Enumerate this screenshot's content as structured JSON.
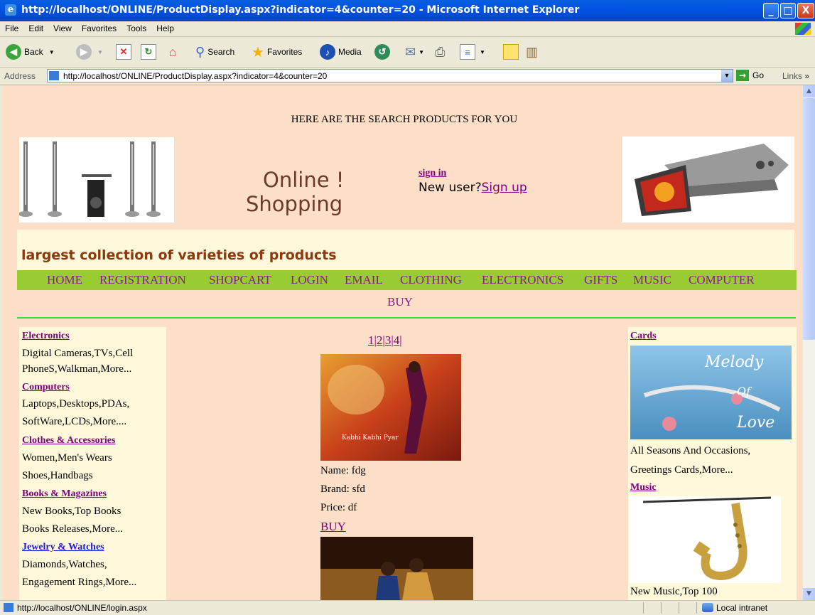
{
  "window": {
    "title": "http://localhost/ONLINE/ProductDisplay.aspx?indicator=4&counter=20 - Microsoft Internet Explorer",
    "minimize": "_",
    "maximize": "□",
    "close": "X"
  },
  "menu": [
    "File",
    "Edit",
    "View",
    "Favorites",
    "Tools",
    "Help"
  ],
  "toolbar": {
    "back_label": "Back",
    "search_label": "Search",
    "favorites_label": "Favorites",
    "media_label": "Media"
  },
  "address": {
    "label": "Address",
    "url": "http://localhost/ONLINE/ProductDisplay.aspx?indicator=4&counter=20",
    "go_label": "Go",
    "links_label": "Links"
  },
  "page": {
    "heading": "HERE ARE THE SEARCH PRODUCTS FOR YOU",
    "logo_line1": "Online !",
    "logo_line2": "Shopping",
    "sign_in": "sign in",
    "new_user": "New user?",
    "sign_up": "Sign up",
    "tagline": "largest collection of varieties of products",
    "nav": [
      "HOME",
      "REGISTRATION",
      "SHOPCART",
      "LOGIN",
      "EMAIL",
      "CLOTHING",
      "ELECTRONICS",
      "GIFTS",
      "MUSIC",
      "COMPUTER"
    ],
    "nav_buy": "BUY",
    "left": {
      "electronics": "Electronics",
      "electronics_1": "Digital Cameras,TVs,Cell",
      "electronics_2": "PhoneS,Walkman,More...",
      "computers": "Computers",
      "computers_1": "Laptops,Desktops,PDAs,",
      "computers_2": "SoftWare,LCDs,More....",
      "clothes": "Clothes & Accessories",
      "clothes_1": "Women,Men's Wears",
      "clothes_2": "Shoes,Handbags",
      "books": "Books & Magazines",
      "books_1": "New Books,Top Books",
      "books_2": "Books Releases,More...",
      "jewelry": "Jewelry & Watches",
      "jewelry_1": "Diamonds,Watches,",
      "jewelry_2": "Engagement Rings,More..."
    },
    "pager": [
      "1",
      "2",
      "3",
      "4"
    ],
    "product": {
      "name": "Name: fdg",
      "brand": "Brand: sfd",
      "price": "Price: df",
      "buy": "BUY",
      "poster_caption": "Kabhi Kabhi Pyar"
    },
    "right": {
      "cards": "Cards",
      "card_image_text": "Melody Of Love",
      "cards_1": "All Seasons And Occasions,",
      "cards_2": "Greetings Cards,More...",
      "music": "Music",
      "music_1": "New Music,Top 100"
    }
  },
  "status": {
    "text": "http://localhost/ONLINE/login.aspx",
    "zone": "Local intranet"
  }
}
